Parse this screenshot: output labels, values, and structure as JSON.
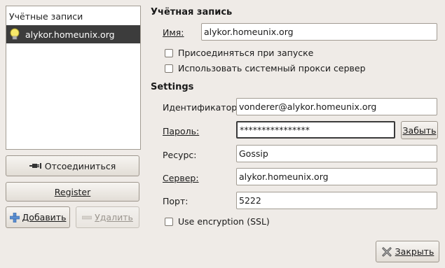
{
  "accounts_list": {
    "header": "Учётные записи",
    "items": [
      {
        "label": "alykor.homeunix.org",
        "icon": "lightbulb-icon",
        "selected": true
      }
    ]
  },
  "left_buttons": {
    "disconnect": "Отсоединиться",
    "register": "Register",
    "add": "Добавить",
    "remove": "Удалить"
  },
  "account_section": {
    "title": "Учётная запись",
    "name_label": "Имя:",
    "name_value": "alykor.homeunix.org",
    "connect_on_start": {
      "label": "Присоединяться при запуске",
      "checked": false
    },
    "use_system_proxy": {
      "label": "Использовать системный прокси сервер",
      "checked": false
    }
  },
  "settings_section": {
    "title": "Settings",
    "identifier_label": "Идентификатор:",
    "identifier_value": "vonderer@alykor.homeunix.org",
    "password_label": "Пароль:",
    "password_value": "****************",
    "forget_button": "Забыть",
    "resource_label": "Ресурс:",
    "resource_value": "Gossip",
    "server_label": "Сервер:",
    "server_value": "alykor.homeunix.org",
    "port_label": "Порт:",
    "port_value": "5222",
    "use_encryption": {
      "label": "Use encryption (SSL)",
      "checked": false
    }
  },
  "footer": {
    "close_button": "Закрыть"
  }
}
